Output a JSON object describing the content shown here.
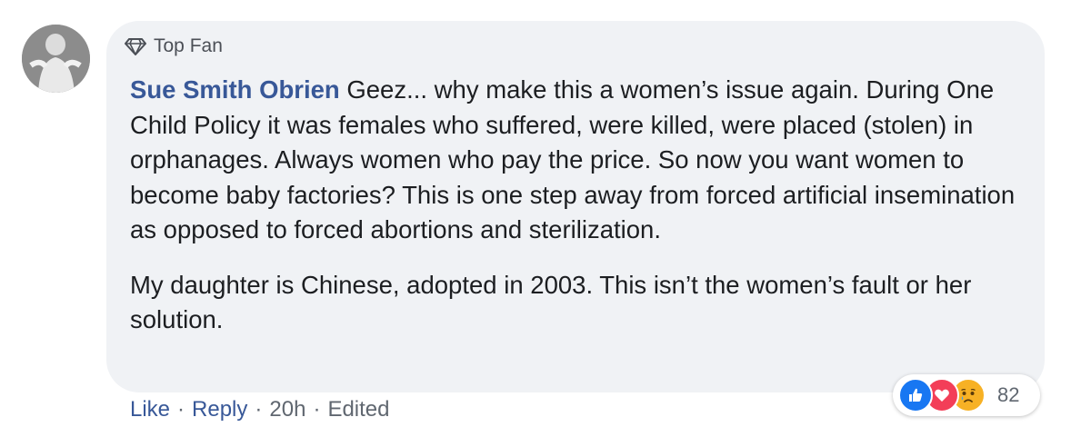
{
  "comment": {
    "badge_label": "Top Fan",
    "author_name": "Sue Smith Obrien",
    "paragraph_1": "Geez... why make this a women’s issue again. During One Child Policy it was females who suffered, were killed, were placed (stolen) in orphanages. Always women who pay the price. So now you want women to become baby factories? This is one step away from forced artificial insemination as opposed to forced abortions and sterilization.",
    "paragraph_2": "My daughter is Chinese, adopted in 2003. This isn’t the women’s fault or her solution.",
    "actions": {
      "like_label": "Like",
      "reply_label": "Reply",
      "separator": "·",
      "time": "20h",
      "edited_label": "Edited"
    },
    "reactions": {
      "types": [
        "like-icon",
        "love-icon",
        "sad-icon"
      ],
      "count": "82"
    }
  },
  "colors": {
    "bubble_bg": "#f0f2f5",
    "author": "#385898",
    "link": "#385898",
    "meta": "#606770",
    "like": "#1877f2",
    "love": "#f33e58",
    "sad": "#f7b125"
  }
}
